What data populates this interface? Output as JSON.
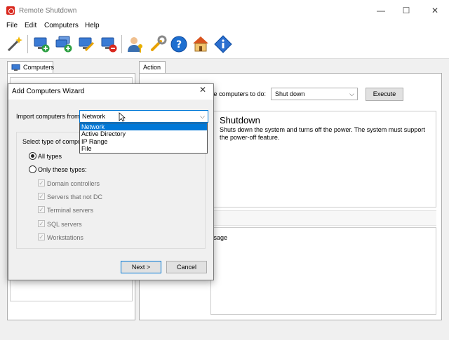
{
  "window": {
    "title": "Remote Shutdown",
    "minimize": "—",
    "maximize": "☐",
    "close": "✕"
  },
  "menu": [
    "File",
    "Edit",
    "Computers",
    "Help"
  ],
  "toolbar": {
    "icons": [
      "magic-wand-icon",
      "add-computer-icon",
      "add-computers-icon",
      "edit-computer-icon",
      "remove-computer-icon",
      "user-key-icon",
      "wrench-icon",
      "help-icon",
      "home-icon",
      "info-icon"
    ]
  },
  "left_panel": {
    "tab_label": "Computers"
  },
  "right_panel": {
    "tab_label": "Action",
    "choose_label": "se computers to do:",
    "action_value": "Shut down",
    "execute_label": "Execute",
    "description_title": "Shutdown",
    "description_text": "Shuts down the system and turns off the power. The system must support the power-off feature.",
    "message_text": "ssage"
  },
  "dialog": {
    "title": "Add Computers Wizard",
    "close": "✕",
    "import_label": "Import computers from",
    "import_value": "Network",
    "dropdown_options": [
      "Network",
      "Active Directory",
      "IP Range",
      "File"
    ],
    "group_title": "Select type of compu",
    "radio_all": "All types",
    "radio_only": "Only these types:",
    "types": [
      "Domain controllers",
      "Servers that not DC",
      "Terminal servers",
      "SQL servers",
      "Workstations"
    ],
    "next_label": "Next >",
    "cancel_label": "Cancel"
  },
  "colors": {
    "accent": "#0078d7",
    "app_icon": "#d9281e"
  }
}
